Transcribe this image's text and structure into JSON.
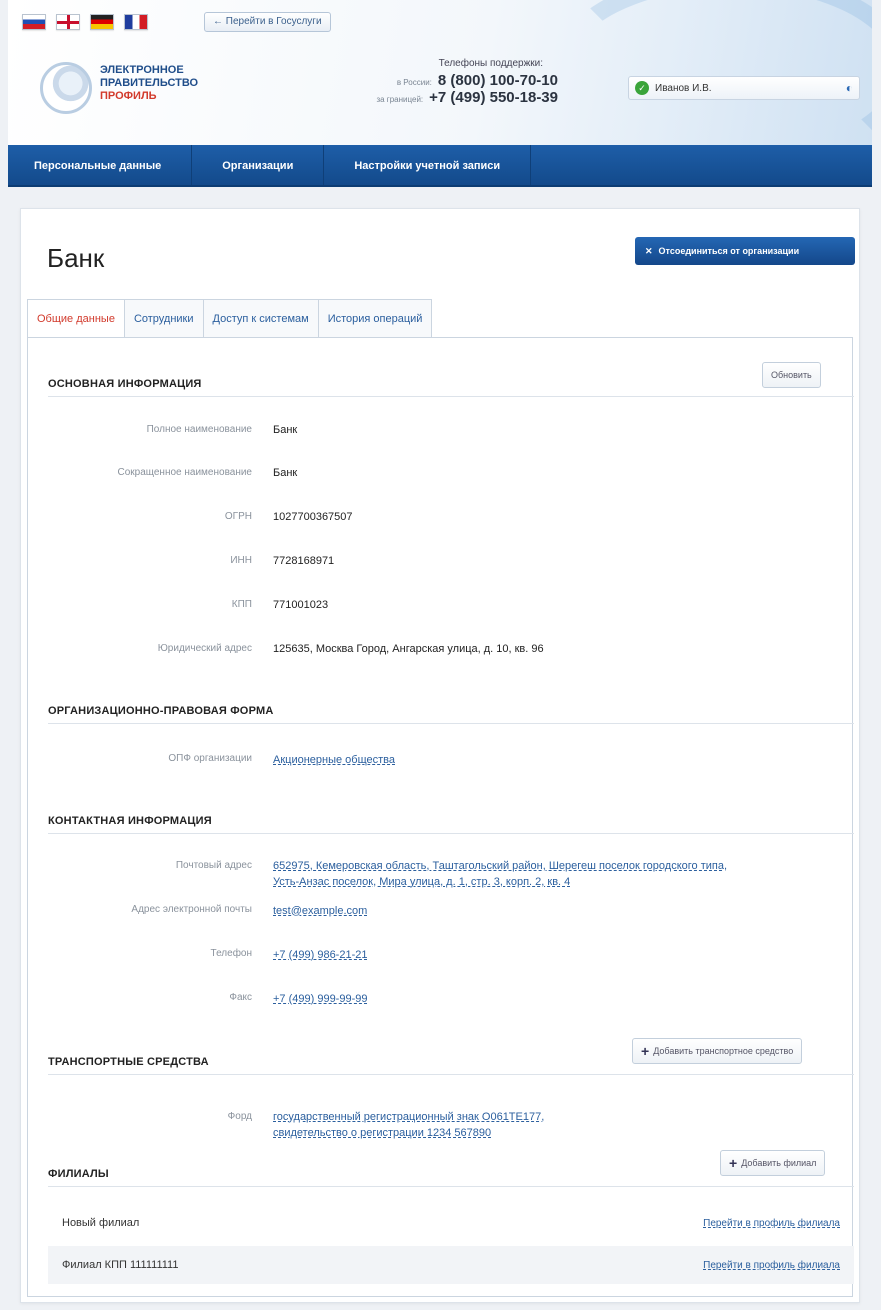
{
  "header": {
    "portal_link": "← Перейти в Госуслуги",
    "logo_line1": "ЭЛЕКТРОННОЕ",
    "logo_line2": "ПРАВИТЕЛЬСТВО",
    "logo_line3": "ПРОФИЛЬ",
    "support_title": "Телефоны поддержки:",
    "support_ru_label": "в России:",
    "support_ru_phone": "8 (800) 100-70-10",
    "support_abroad_label": "за границей:",
    "support_abroad_phone": "+7 (499) 550-18-39",
    "user_name": "Иванов И.В."
  },
  "nav": {
    "items": [
      "Персональные данные",
      "Организации",
      "Настройки учетной записи"
    ]
  },
  "page": {
    "title": "Банк",
    "leave_button": "Отсоединиться от организации"
  },
  "tabs": [
    "Общие данные",
    "Сотрудники",
    "Доступ к системам",
    "История операций"
  ],
  "basic": {
    "title": "ОСНОВНАЯ ИНФОРМАЦИЯ",
    "refresh_button": "Обновить",
    "rows": [
      {
        "label": "Полное наименование",
        "value": "Банк"
      },
      {
        "label": "Сокращенное наименование",
        "value": "Банк"
      },
      {
        "label": "ОГРН",
        "value": "1027700367507"
      },
      {
        "label": "ИНН",
        "value": "7728168971"
      },
      {
        "label": "КПП",
        "value": "771001023"
      },
      {
        "label": "Юридический адрес",
        "value": "125635, Москва Город, Ангарская улица, д. 10, кв. 96"
      }
    ]
  },
  "legal_form": {
    "title": "ОРГАНИЗАЦИОННО-ПРАВОВАЯ ФОРМА",
    "label": "ОПФ организации",
    "value": "Акционерные общества"
  },
  "contacts": {
    "title": "КОНТАКТНАЯ ИНФОРМАЦИЯ",
    "postal_label": "Почтовый адрес",
    "postal_line1": "652975, Кемеровская область, Таштагольский район, Шерегеш поселок городского типа,",
    "postal_line2": "Усть-Анзас поселок, Мира улица, д. 1, стр. 3, корп. 2, кв. 4",
    "email_label": "Адрес электронной почты",
    "email_value": "test@example.com",
    "phone_label": "Телефон",
    "phone_value": "+7 (499) 986-21-21",
    "fax_label": "Факс",
    "fax_value": "+7 (499) 999-99-99"
  },
  "vehicles": {
    "title": "ТРАНСПОРТНЫЕ СРЕДСТВА",
    "add_button": "Добавить транспортное средство",
    "label": "Форд",
    "value_line1": "государственный регистрационный знак О061ТЕ177,",
    "value_line2": "свидетельство о регистрации 1234 567890"
  },
  "branches": {
    "title": "ФИЛИАЛЫ",
    "add_button": "Добавить филиал",
    "items": [
      {
        "name": "Новый филиал",
        "link": "Перейти в профиль филиала"
      },
      {
        "name": "Филиал КПП 111111111",
        "link": "Перейти в профиль филиала"
      }
    ]
  }
}
